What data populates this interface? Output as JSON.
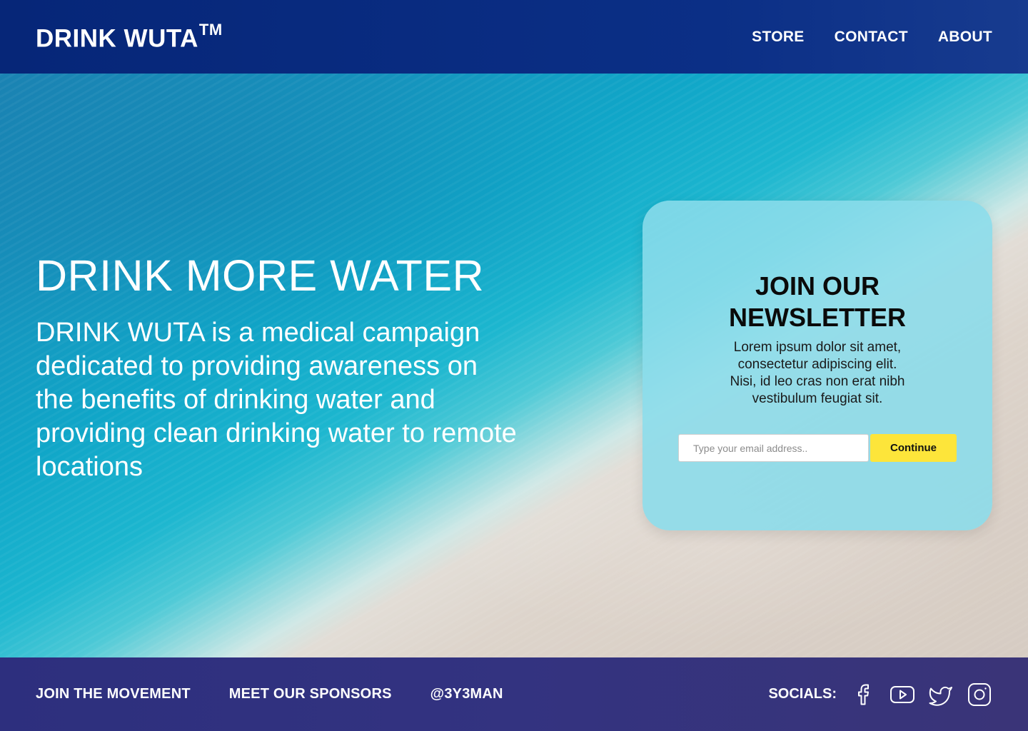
{
  "header": {
    "logo": "DRINK WUTA",
    "logo_mark": "TM",
    "nav": [
      "STORE",
      "CONTACT",
      "ABOUT"
    ]
  },
  "hero": {
    "title": "DRINK MORE WATER",
    "description": "DRINK WUTA is a medical campaign dedicated to providing awareness on the benefits of drinking water and providing clean drinking water to remote locations"
  },
  "newsletter": {
    "title_line1": "JOIN OUR",
    "title_line2": "NEWSLETTER",
    "text": "Lorem ipsum dolor sit amet, consectetur adipiscing elit. Nisi, id leo cras non erat nibh vestibulum feugiat sit.",
    "email_placeholder": "Type your email address..",
    "email_value": "",
    "button_label": "Continue"
  },
  "footer": {
    "links": [
      "JOIN THE MOVEMENT",
      "MEET OUR SPONSORS",
      "@3Y3MAN"
    ],
    "socials_label": "SOCIALS:",
    "socials": [
      "facebook-icon",
      "youtube-icon",
      "twitter-icon",
      "instagram-icon"
    ]
  },
  "colors": {
    "header_bg": "#062678",
    "footer_bg": "#333380",
    "card_bg": "#8adcea",
    "button_bg": "#fde53a",
    "text_light": "#ffffff"
  }
}
